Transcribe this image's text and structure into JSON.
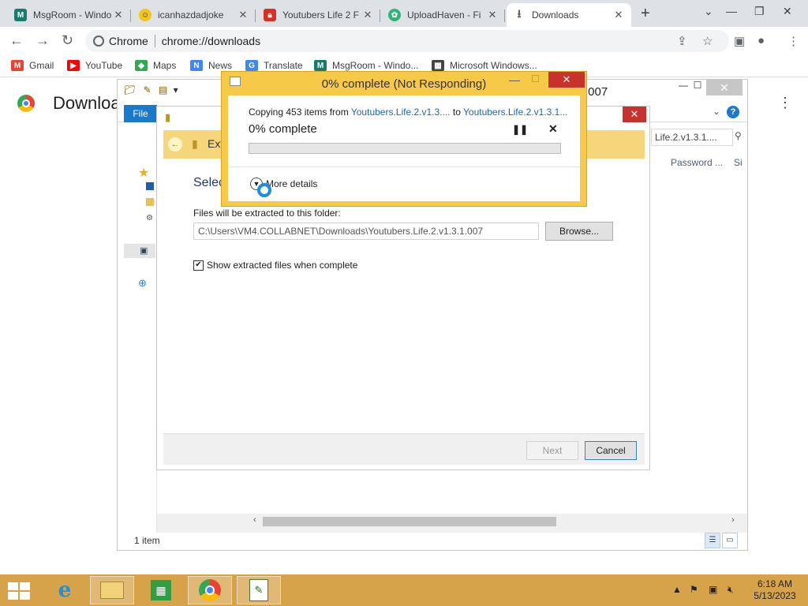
{
  "tabs": [
    {
      "title": "MsgRoom - Windo",
      "icon": "msgroom-icon",
      "color": "#1a7a6e"
    },
    {
      "title": "icanhazdadjoke",
      "icon": "emoji-icon",
      "color": "#f5c518"
    },
    {
      "title": "Youtubers Life 2 F",
      "icon": "lock-icon",
      "color": "#d93025"
    },
    {
      "title": "UploadHaven - Fi",
      "icon": "uploadhaven-icon",
      "color": "#2bb673"
    },
    {
      "title": "Downloads",
      "icon": "download-icon",
      "color": "#5f6368"
    }
  ],
  "omnibox": {
    "site": "Chrome",
    "url": "chrome://downloads"
  },
  "bookmarks": [
    {
      "label": "Gmail",
      "color": "#ea4335",
      "glyph": "M"
    },
    {
      "label": "YouTube",
      "color": "#ff0000",
      "glyph": "▶"
    },
    {
      "label": "Maps",
      "color": "#34a853",
      "glyph": "◆"
    },
    {
      "label": "News",
      "color": "#4285f4",
      "glyph": "N"
    },
    {
      "label": "Translate",
      "color": "#4285f4",
      "glyph": "G"
    },
    {
      "label": "MsgRoom - Windo...",
      "color": "#1a7a6e",
      "glyph": "M"
    },
    {
      "label": "Microsoft Windows...",
      "color": "#444444",
      "glyph": "▦"
    }
  ],
  "page": {
    "title": "Downloa"
  },
  "explorer": {
    "title_tail": ".007",
    "file_tab": "File",
    "search_text": "Life.2.v1.3.1....",
    "columns": [
      "Password ...",
      "Si"
    ],
    "status": "1 item"
  },
  "wizard": {
    "header": "Ext",
    "heading": "Selec",
    "folder_label": "Files will be extracted to this folder:",
    "folder_path": "C:\\Users\\VM4.COLLABNET\\Downloads\\Youtubers.Life.2.v1.3.1.007",
    "browse": "Browse...",
    "show_files": "Show extracted files when complete",
    "show_files_checked": true,
    "next": "Next",
    "cancel": "Cancel"
  },
  "progress": {
    "title": "0% complete (Not Responding)",
    "copying_prefix": "Copying 453 items from",
    "from": "Youtubers.Life.2.v1.3....",
    "to_word": "to",
    "to": "Youtubers.Life.2.v1.3.1...",
    "percent_text": "0% complete",
    "percent": 0,
    "more_details": "More details"
  },
  "taskbar": {
    "time": "6:18 AM",
    "date": "5/13/2023",
    "accent": "#d6a24a"
  }
}
